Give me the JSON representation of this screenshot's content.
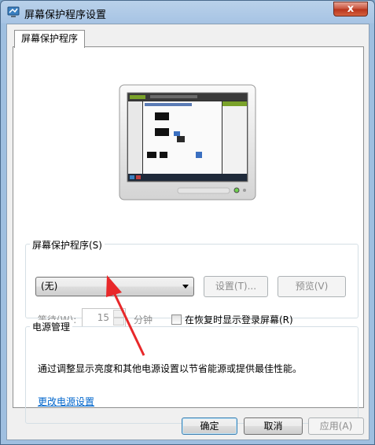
{
  "window": {
    "title": "屏幕保护程序设置",
    "close_label": "x"
  },
  "tabs": [
    {
      "label": "屏幕保护程序"
    }
  ],
  "screensaver_group": {
    "label": "屏幕保护程序(S)",
    "selected": "(无)",
    "settings_button": "设置(T)...",
    "preview_button": "预览(V)",
    "wait_label": "等待(W):",
    "wait_value": "15",
    "minutes_label": "分钟",
    "resume_label": "在恢复时显示登录屏幕(R)",
    "resume_checked": false
  },
  "power_group": {
    "label": "电源管理",
    "description": "通过调整显示亮度和其他电源设置以节省能源或提供最佳性能。",
    "link": "更改电源设置"
  },
  "footer": {
    "ok": "确定",
    "cancel": "取消",
    "apply": "应用(A)"
  },
  "colors": {
    "link": "#0066cc",
    "annotation_arrow": "#e8282a",
    "close_button": "#c75039"
  }
}
